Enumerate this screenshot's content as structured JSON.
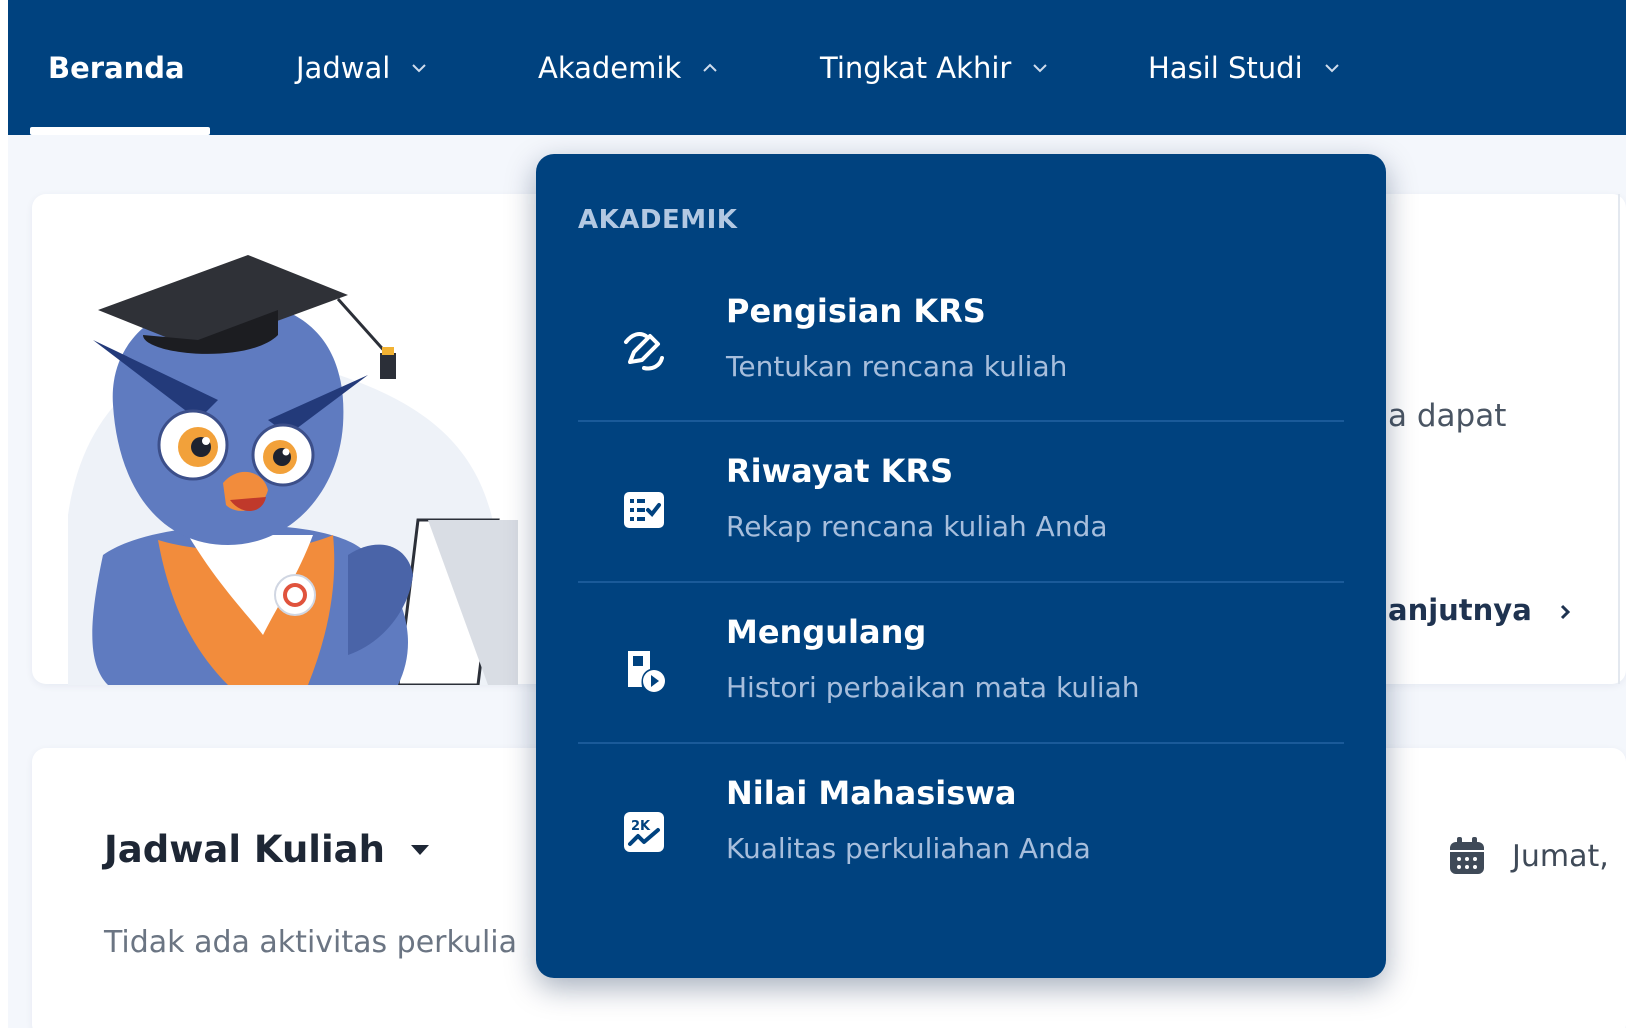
{
  "navbar": {
    "items": [
      {
        "label": "Beranda",
        "active": true,
        "has_chevron": false
      },
      {
        "label": "Jadwal",
        "active": false,
        "has_chevron": true,
        "chevron": "chevron-down-icon"
      },
      {
        "label": "Akademik",
        "active": false,
        "has_chevron": true,
        "chevron": "chevron-up-icon"
      },
      {
        "label": "Tingkat Akhir",
        "active": false,
        "has_chevron": true,
        "chevron": "chevron-down-icon"
      },
      {
        "label": "Hasil Studi",
        "active": false,
        "has_chevron": true,
        "chevron": "chevron-down-icon"
      }
    ],
    "background": "#00427f"
  },
  "hero": {
    "text_fragment": "a dapat",
    "link_fragment": "anjutnya"
  },
  "schedule": {
    "title": "Jadwal Kuliah",
    "empty_text": "Tidak ada aktivitas perkulia",
    "date": "Jumat,"
  },
  "dropdown": {
    "heading": "AKADEMIK",
    "items": [
      {
        "title": "Pengisian KRS",
        "description": "Tentukan rencana kuliah",
        "icon": "pencil-edit-icon"
      },
      {
        "title": "Riwayat KRS",
        "description": "Rekap rencana kuliah Anda",
        "icon": "checklist-icon"
      },
      {
        "title": "Mengulang",
        "description": "Histori perbaikan mata kuliah",
        "icon": "repeat-document-icon"
      },
      {
        "title": "Nilai Mahasiswa",
        "description": "Kualitas perkuliahan Anda",
        "icon": "grade-chart-icon"
      }
    ]
  },
  "colors": {
    "primary": "#00427f",
    "accent": "#f28c3c",
    "page_bg": "#f4f7fc"
  }
}
